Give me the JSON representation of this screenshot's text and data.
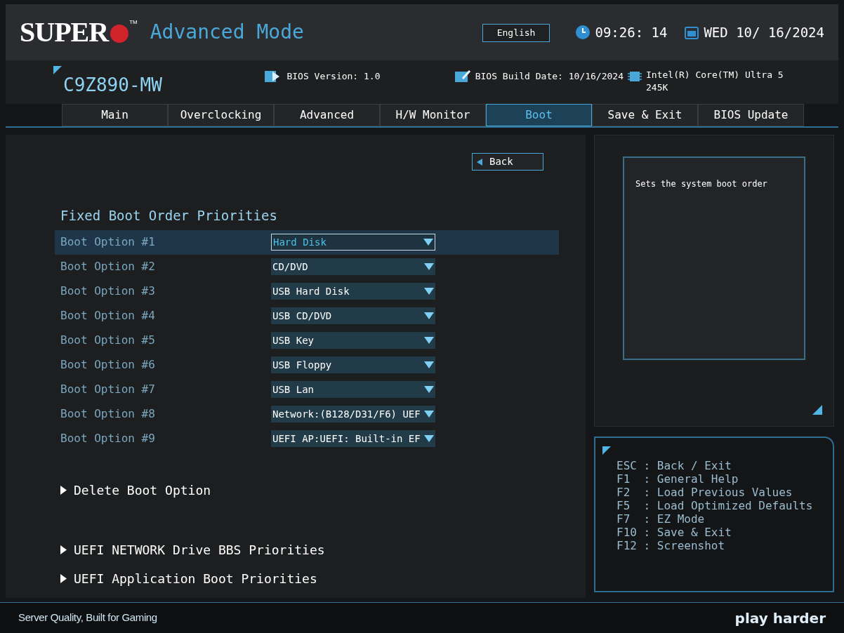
{
  "header": {
    "logo": "SUPER",
    "trademark": "TM",
    "mode": "Advanced Mode",
    "language": "English",
    "time": "09:26: 14",
    "date": "WED 10/ 16/2024"
  },
  "info": {
    "model": "C9Z890-MW",
    "bios_version": "BIOS Version: 1.0",
    "build_date": "BIOS Build Date: 10/16/2024",
    "cpu": "Intel(R) Core(TM) Ultra 5 245K"
  },
  "tabs": [
    {
      "label": "Main",
      "selected": false
    },
    {
      "label": "Overclocking",
      "selected": false
    },
    {
      "label": "Advanced",
      "selected": false
    },
    {
      "label": "H/W Monitor",
      "selected": false
    },
    {
      "label": "Boot",
      "selected": true
    },
    {
      "label": "Save & Exit",
      "selected": false
    },
    {
      "label": "BIOS Update",
      "selected": false
    }
  ],
  "back_button": "Back",
  "section_title": "Fixed Boot Order Priorities",
  "boot_options": [
    {
      "label": "Boot Option #1",
      "value": "Hard Disk",
      "selected": true
    },
    {
      "label": "Boot Option #2",
      "value": "CD/DVD",
      "selected": false
    },
    {
      "label": "Boot Option #3",
      "value": "USB Hard Disk",
      "selected": false
    },
    {
      "label": "Boot Option #4",
      "value": "USB CD/DVD",
      "selected": false
    },
    {
      "label": "Boot Option #5",
      "value": "USB Key",
      "selected": false
    },
    {
      "label": "Boot Option #6",
      "value": "USB Floppy",
      "selected": false
    },
    {
      "label": "Boot Option #7",
      "value": "USB Lan",
      "selected": false
    },
    {
      "label": "Boot Option #8",
      "value": "Network:(B128/D31/F6) UEF",
      "selected": false
    },
    {
      "label": "Boot Option #9",
      "value": "UEFI AP:UEFI: Built-in EF",
      "selected": false
    }
  ],
  "submenus": [
    {
      "label": "Delete Boot Option"
    },
    {
      "label": "UEFI NETWORK Drive BBS Priorities"
    },
    {
      "label": "UEFI Application Boot Priorities"
    }
  ],
  "help_text": "Sets the system boot order",
  "hotkeys": [
    "ESC : Back / Exit",
    "F1  : General Help",
    "F2  : Load Previous Values",
    "F5  : Load Optimized Defaults",
    "F7  : EZ Mode",
    "F10 : Save & Exit",
    "F12 : Screenshot"
  ],
  "footer": {
    "tagline": "Server Quality, Built for Gaming",
    "slogan": "play harder"
  }
}
